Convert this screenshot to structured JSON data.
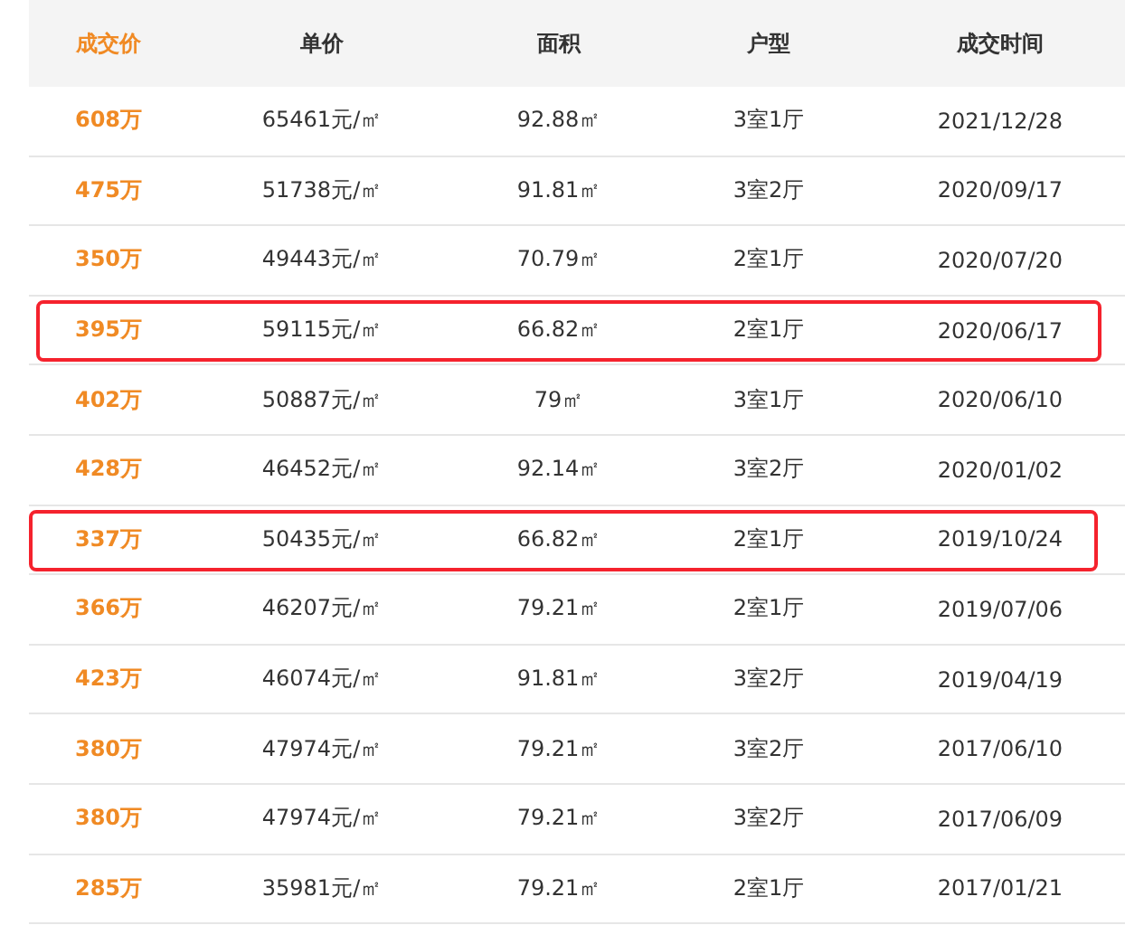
{
  "table": {
    "columns": [
      "成交价",
      "单价",
      "面积",
      "户型",
      "成交时间"
    ],
    "rows": [
      {
        "price": "608万",
        "unit_price": "65461元/㎡",
        "area": "92.88㎡",
        "layout": "3室1厅",
        "date": "2021/12/28",
        "highlighted": false
      },
      {
        "price": "475万",
        "unit_price": "51738元/㎡",
        "area": "91.81㎡",
        "layout": "3室2厅",
        "date": "2020/09/17",
        "highlighted": false
      },
      {
        "price": "350万",
        "unit_price": "49443元/㎡",
        "area": "70.79㎡",
        "layout": "2室1厅",
        "date": "2020/07/20",
        "highlighted": false
      },
      {
        "price": "395万",
        "unit_price": "59115元/㎡",
        "area": "66.82㎡",
        "layout": "2室1厅",
        "date": "2020/06/17",
        "highlighted": true
      },
      {
        "price": "402万",
        "unit_price": "50887元/㎡",
        "area": "79㎡",
        "layout": "3室1厅",
        "date": "2020/06/10",
        "highlighted": false
      },
      {
        "price": "428万",
        "unit_price": "46452元/㎡",
        "area": "92.14㎡",
        "layout": "3室2厅",
        "date": "2020/01/02",
        "highlighted": false
      },
      {
        "price": "337万",
        "unit_price": "50435元/㎡",
        "area": "66.82㎡",
        "layout": "2室1厅",
        "date": "2019/10/24",
        "highlighted": true
      },
      {
        "price": "366万",
        "unit_price": "46207元/㎡",
        "area": "79.21㎡",
        "layout": "2室1厅",
        "date": "2019/07/06",
        "highlighted": false
      },
      {
        "price": "423万",
        "unit_price": "46074元/㎡",
        "area": "91.81㎡",
        "layout": "3室2厅",
        "date": "2019/04/19",
        "highlighted": false
      },
      {
        "price": "380万",
        "unit_price": "47974元/㎡",
        "area": "79.21㎡",
        "layout": "3室2厅",
        "date": "2017/06/10",
        "highlighted": false
      },
      {
        "price": "380万",
        "unit_price": "47974元/㎡",
        "area": "79.21㎡",
        "layout": "3室2厅",
        "date": "2017/06/09",
        "highlighted": false
      },
      {
        "price": "285万",
        "unit_price": "35981元/㎡",
        "area": "79.21㎡",
        "layout": "2室1厅",
        "date": "2017/01/21",
        "highlighted": false
      }
    ]
  }
}
